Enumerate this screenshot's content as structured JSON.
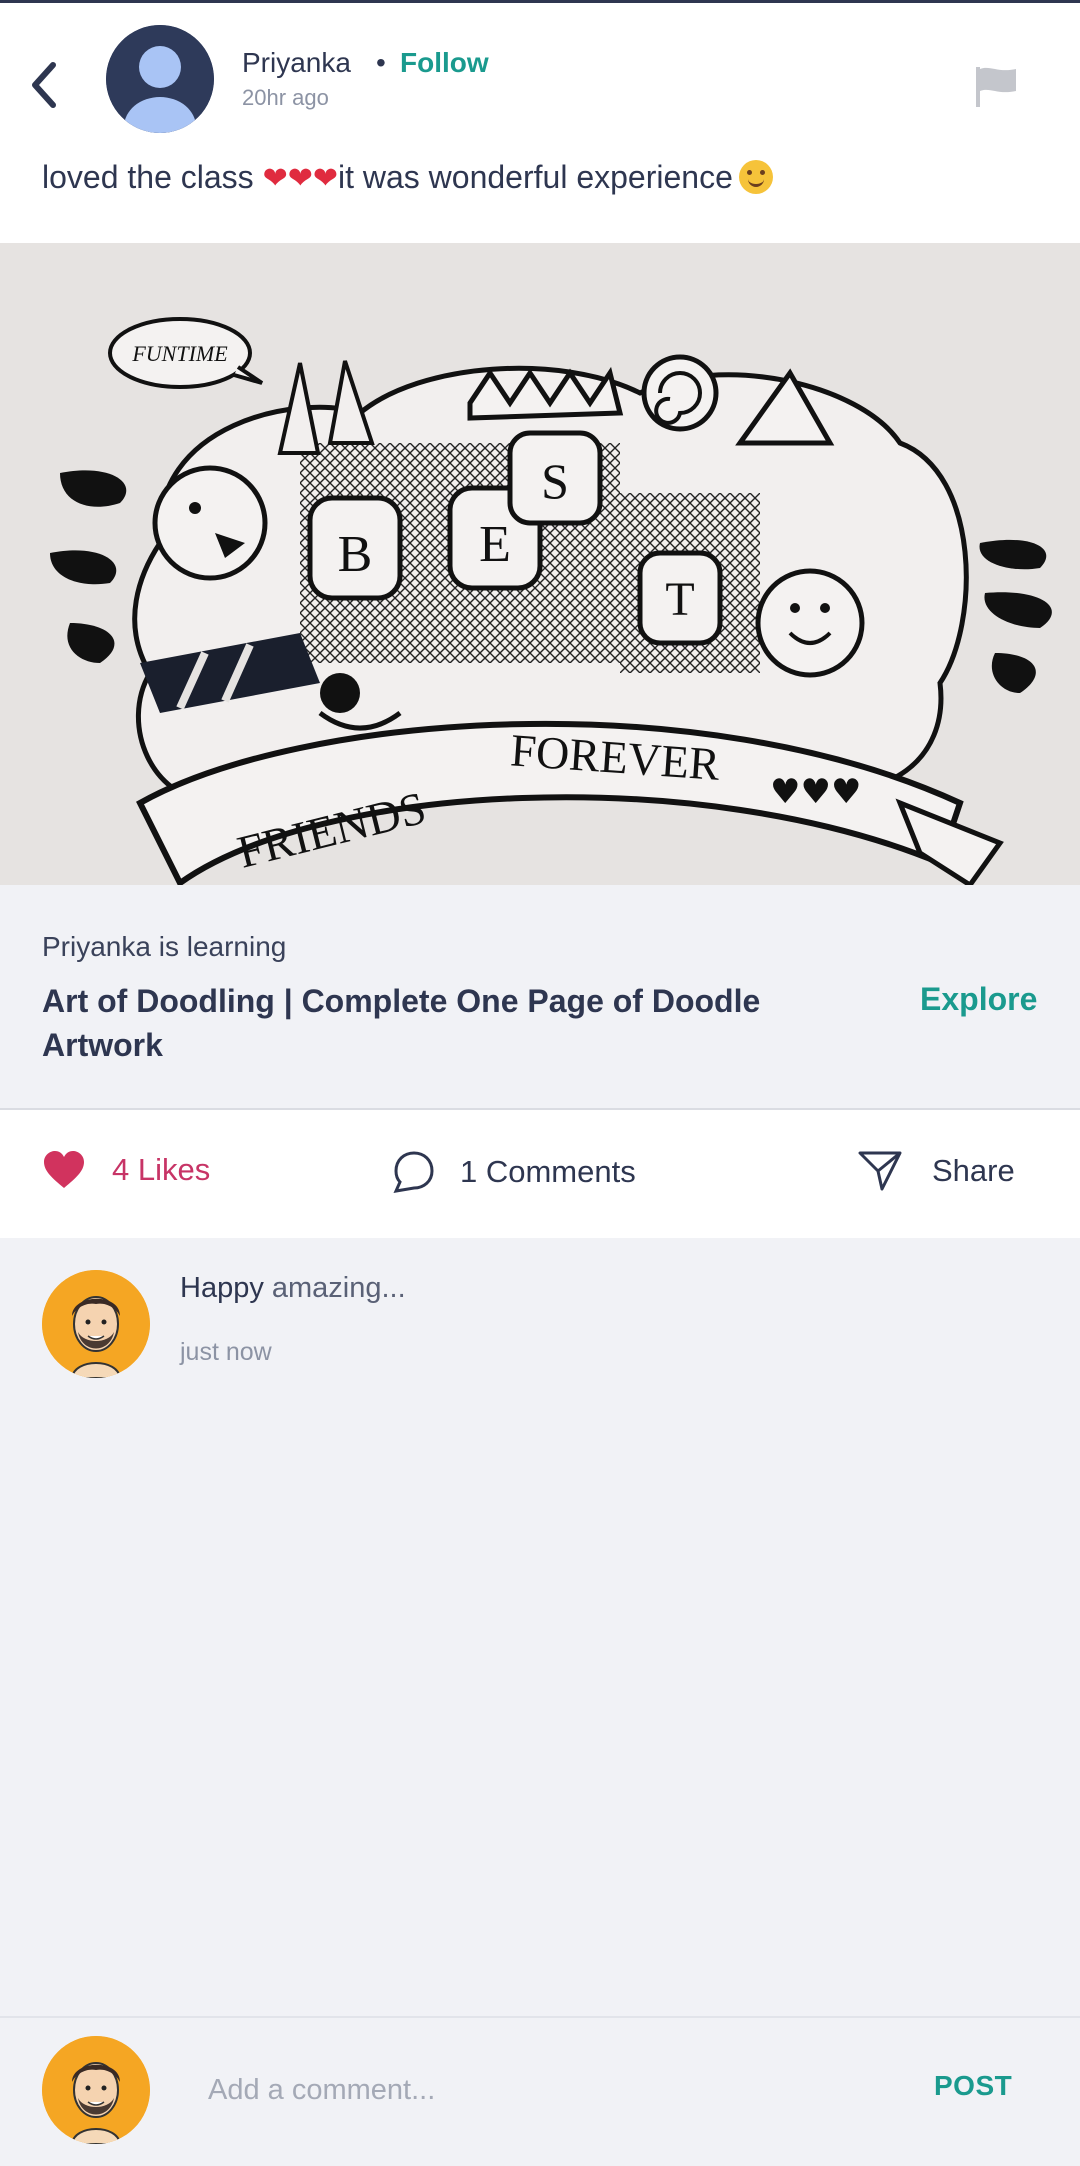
{
  "post": {
    "author_name": "Priyanka",
    "separator": "•",
    "follow_label": "Follow",
    "time_ago": "20hr ago",
    "text_before": "loved the class ",
    "hearts": "❤❤❤",
    "text_after": "it was wonderful experience"
  },
  "course": {
    "learning_label": "Priyanka is learning",
    "title": "Art of Doodling | Complete One Page of Doodle Artwork",
    "explore_label": "Explore"
  },
  "actions": {
    "likes_label": "4 Likes",
    "comments_label": "1 Comments",
    "share_label": "Share"
  },
  "comments": [
    {
      "user": "Happy",
      "text": " amazing...",
      "time": "just now"
    }
  ],
  "composer": {
    "placeholder": "Add a comment...",
    "post_label": "POST"
  },
  "image": {
    "banner_left": "FRIENDS",
    "banner_right": "FOREVER",
    "bubble_text": "FUNTIME",
    "letters": [
      "B",
      "E",
      "S",
      "T"
    ]
  },
  "colors": {
    "accent": "#1a9a8e",
    "like": "#c73466",
    "text": "#2e3650"
  },
  "icons": [
    "back-arrow-icon",
    "flag-icon",
    "heart-icon",
    "comment-bubble-icon",
    "send-icon"
  ]
}
